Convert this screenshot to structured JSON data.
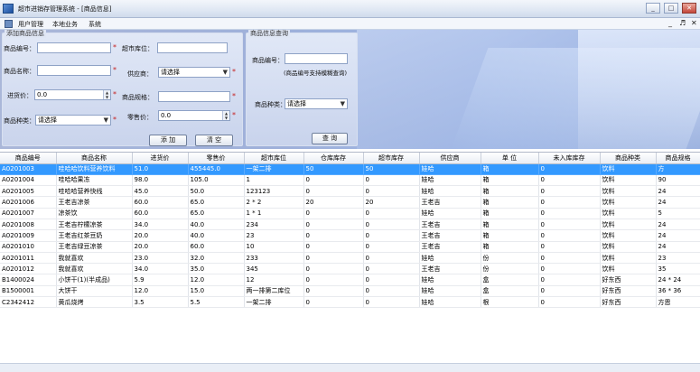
{
  "window": {
    "title": "超市进销存管理系统 - [商品信息]",
    "controls": [
      "_",
      "□",
      "✕"
    ]
  },
  "menubar": {
    "items": [
      "用户管理",
      "本地业务",
      "系统"
    ],
    "mdi_controls": [
      "_",
      "♬",
      "✕"
    ]
  },
  "left_group": {
    "legend": "添加商品信息",
    "fields": {
      "product_id_label": "商品编号：",
      "shelf_label": "超市库位：",
      "product_name_label": "商品名称：",
      "supplier_label": "供应商：",
      "supplier_value": "请选择",
      "purchase_price_label": "进货价：",
      "purchase_price_value": "0.0",
      "spec_label": "商品规格：",
      "category_label": "商品种类：",
      "category_value": "请选择",
      "sale_price_label": "零售价：",
      "sale_price_value": "0.0"
    },
    "add_button": "添 加",
    "clear_button": "清 空"
  },
  "right_group": {
    "legend": "商品信息查询",
    "product_id_label": "商品编号：",
    "hint": "(商品编号支持模糊查询)",
    "category_label": "商品种类：",
    "category_value": "请选择",
    "query_button": "查 询"
  },
  "table": {
    "columns": [
      "商品编号",
      "商品名称",
      "进货价",
      "零售价",
      "超市库位",
      "仓库库存",
      "超市库存",
      "供应商",
      "单 位",
      "未入库库存",
      "商品种类",
      "商品规格"
    ],
    "rows": [
      [
        "A0201003",
        "哇哈哈饮料营养饮料",
        "51.0",
        "455445.0",
        "一架二排",
        "50",
        "50",
        "娃哈",
        "箱",
        "0",
        "饮料",
        "方"
      ],
      [
        "A0201004",
        "哇哈哈果冻",
        "98.0",
        "105.0",
        "1",
        "0",
        "0",
        "娃哈",
        "箱",
        "0",
        "饮料",
        "90"
      ],
      [
        "A0201005",
        "哇哈哈营养快线",
        "45.0",
        "50.0",
        "123123",
        "0",
        "0",
        "娃哈",
        "箱",
        "0",
        "饮料",
        "24"
      ],
      [
        "A0201006",
        "王老吉凉茶",
        "60.0",
        "65.0",
        "2 * 2",
        "20",
        "20",
        "王老吉",
        "箱",
        "0",
        "饮料",
        "24"
      ],
      [
        "A0201007",
        "凉茶饮",
        "60.0",
        "65.0",
        "1 * 1",
        "0",
        "0",
        "娃哈",
        "箱",
        "0",
        "饮料",
        "5"
      ],
      [
        "A0201008",
        "王老吉柠檬凉茶",
        "34.0",
        "40.0",
        "234",
        "0",
        "0",
        "王老吉",
        "箱",
        "0",
        "饮料",
        "24"
      ],
      [
        "A0201009",
        "王老吉红茶豆奶",
        "20.0",
        "40.0",
        "23",
        "0",
        "0",
        "王老吉",
        "箱",
        "0",
        "饮料",
        "24"
      ],
      [
        "A0201010",
        "王老吉绿豆凉茶",
        "20.0",
        "60.0",
        "10",
        "0",
        "0",
        "王老吉",
        "箱",
        "0",
        "饮料",
        "24"
      ],
      [
        "A0201011",
        "我就喜欢",
        "23.0",
        "32.0",
        "233",
        "0",
        "0",
        "娃哈",
        "份",
        "0",
        "饮料",
        "23"
      ],
      [
        "A0201012",
        "我就喜欢",
        "34.0",
        "35.0",
        "345",
        "0",
        "0",
        "王老吉",
        "份",
        "0",
        "饮料",
        "35"
      ],
      [
        "B1400024",
        "小饼干(1)(半成品)",
        "5.9",
        "12.0",
        "12",
        "0",
        "0",
        "娃哈",
        "盒",
        "0",
        "好东西",
        "24 * 24"
      ],
      [
        "B1500001",
        "大饼干",
        "12.0",
        "15.0",
        "两一排第二库位",
        "0",
        "0",
        "娃哈",
        "盒",
        "0",
        "好东西",
        "36 * 36"
      ],
      [
        "C2342412",
        "黄瓜烧烤",
        "3.5",
        "5.5",
        "一架二排",
        "0",
        "0",
        "娃哈",
        "根",
        "0",
        "好东西",
        "方恩"
      ]
    ]
  }
}
